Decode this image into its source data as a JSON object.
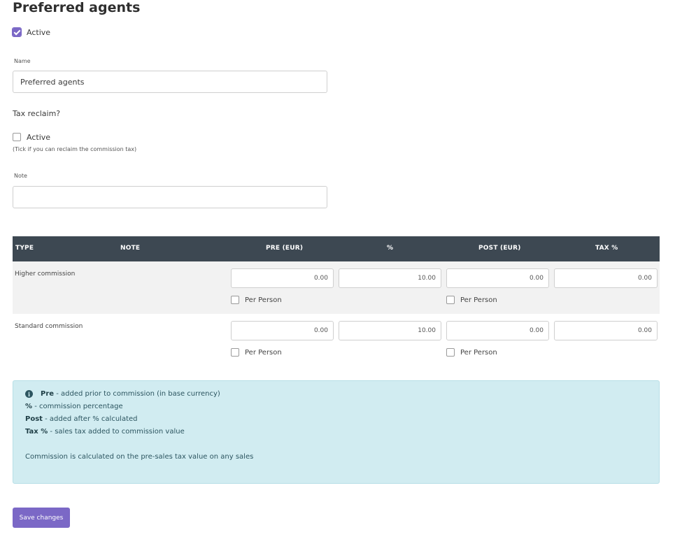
{
  "page": {
    "title": "Preferred agents"
  },
  "active": {
    "label": "Active",
    "checked": true
  },
  "name_field": {
    "label": "Name",
    "value": "Preferred agents"
  },
  "tax_reclaim": {
    "heading": "Tax reclaim?",
    "checkbox_label": "Active",
    "hint": "(Tick if you can reclaim the commission tax)",
    "checked": false
  },
  "note_field": {
    "label": "Note",
    "value": ""
  },
  "table": {
    "headers": {
      "type": "TYPE",
      "note": "NOTE",
      "pre": "PRE (EUR)",
      "pct": "%",
      "post": "POST (EUR)",
      "tax": "TAX %"
    },
    "rows": [
      {
        "type": "Higher commission",
        "pre": "0.00",
        "pct": "10.00",
        "post": "0.00",
        "tax": "0.00",
        "pre_per_person": "Per Person",
        "post_per_person": "Per Person"
      },
      {
        "type": "Standard commission",
        "pre": "0.00",
        "pct": "10.00",
        "post": "0.00",
        "tax": "0.00",
        "pre_per_person": "Per Person",
        "post_per_person": "Per Person"
      }
    ]
  },
  "info": {
    "line1_bold": "Pre",
    "line1_text": " - added prior to commission (in base currency)",
    "line2_bold": "%",
    "line2_text": " - commission percentage",
    "line3_bold": "Post",
    "line3_text": " - added after % calculated",
    "line4_bold": "Tax %",
    "line4_text": " - sales tax added to commission value",
    "line5_text": "Commission is calculated on the pre-sales tax value on any sales"
  },
  "save_button": {
    "label": "Save changes"
  },
  "colors": {
    "accent": "#7b68c6",
    "table_header": "#3d4852",
    "info_bg": "#d1ecf1"
  },
  "icons": {
    "info": "info-circle-icon",
    "check": "check-icon"
  }
}
